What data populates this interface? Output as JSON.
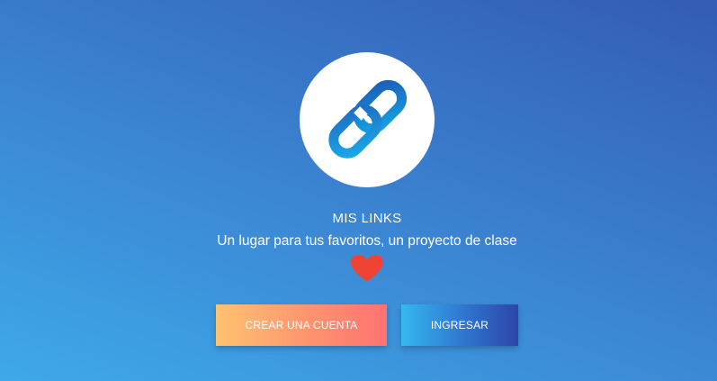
{
  "brand": {
    "logo_icon": "chain-link-icon",
    "title": "MIS LINKS",
    "tagline": "Un lugar para tus favoritos, un proyecto de clase",
    "heart_icon": "heart-icon",
    "heart_color": "#ef4434"
  },
  "actions": {
    "create_account_label": "CREAR UNA CUENTA",
    "login_label": "INGRESAR"
  },
  "colors": {
    "background_start": "#3ea9e8",
    "background_end": "#345cb4",
    "create_gradient_start": "#ffc271",
    "create_gradient_end": "#ff7272",
    "login_gradient_start": "#35b8ef",
    "login_gradient_end": "#2d46a8"
  }
}
